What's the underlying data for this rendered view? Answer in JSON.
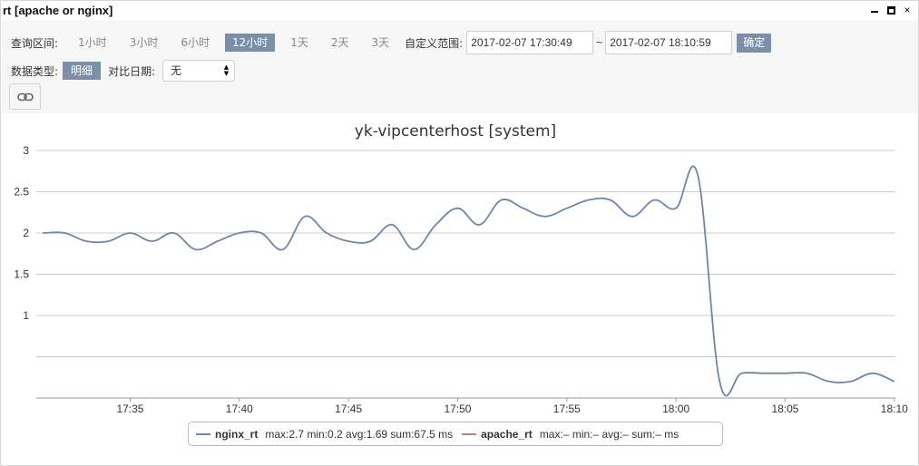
{
  "window": {
    "title": "rt [apache or nginx]",
    "minimize_label": "",
    "maximize_label": "",
    "close_label": "×"
  },
  "query": {
    "range_label": "查询区间:",
    "ranges": [
      "1小时",
      "3小时",
      "6小时",
      "12小时",
      "1天",
      "2天",
      "3天"
    ],
    "active_range": "12小时",
    "custom_label": "自定义范围:",
    "start": "2017-02-07 17:30:49",
    "tilde": "~",
    "end": "2017-02-07 18:10:59",
    "confirm_label": "确定"
  },
  "options": {
    "data_type_label": "数据类型:",
    "data_type_value": "明细",
    "compare_label": "对比日期:",
    "compare_value": "无"
  },
  "colors": {
    "accent": "#7b8fa8",
    "nginx": "#6d87a8",
    "apache": "#c87b7b",
    "grid": "#cccccc"
  },
  "chart_data": {
    "type": "line",
    "title": "yk-vipcenterhost [system]",
    "xlabel": "",
    "ylabel": "",
    "ylim": [
      0,
      3
    ],
    "yticks": [
      "1",
      "1.5",
      "2",
      "2.5",
      "3"
    ],
    "xticks": [
      "17:35",
      "17:40",
      "17:45",
      "17:50",
      "17:55",
      "18:00",
      "18:05",
      "18:10"
    ],
    "grid": true,
    "legend_position": "bottom",
    "series": [
      {
        "name": "nginx_rt",
        "stats": "max:2.7 min:0.2 avg:1.69 sum:67.5 ms",
        "x": [
          "17:31",
          "17:32",
          "17:33",
          "17:34",
          "17:35",
          "17:36",
          "17:37",
          "17:38",
          "17:39",
          "17:40",
          "17:41",
          "17:42",
          "17:43",
          "17:44",
          "17:45",
          "17:46",
          "17:47",
          "17:48",
          "17:49",
          "17:50",
          "17:51",
          "17:52",
          "17:53",
          "17:54",
          "17:55",
          "17:56",
          "17:57",
          "17:58",
          "17:59",
          "18:00",
          "18:01",
          "18:02",
          "18:03",
          "18:04",
          "18:05",
          "18:06",
          "18:07",
          "18:08",
          "18:09",
          "18:10"
        ],
        "values": [
          2.0,
          2.0,
          1.9,
          1.9,
          2.0,
          1.9,
          2.0,
          1.8,
          1.9,
          2.0,
          2.0,
          1.8,
          2.2,
          2.0,
          1.9,
          1.9,
          2.1,
          1.8,
          2.1,
          2.3,
          2.1,
          2.4,
          2.3,
          2.2,
          2.3,
          2.4,
          2.4,
          2.2,
          2.4,
          2.3,
          2.7,
          0.2,
          0.3,
          0.3,
          0.3,
          0.3,
          0.2,
          0.2,
          0.3,
          0.2
        ]
      },
      {
        "name": "apache_rt",
        "stats": "max:– min:– avg:– sum:– ms",
        "x": [],
        "values": []
      }
    ]
  }
}
